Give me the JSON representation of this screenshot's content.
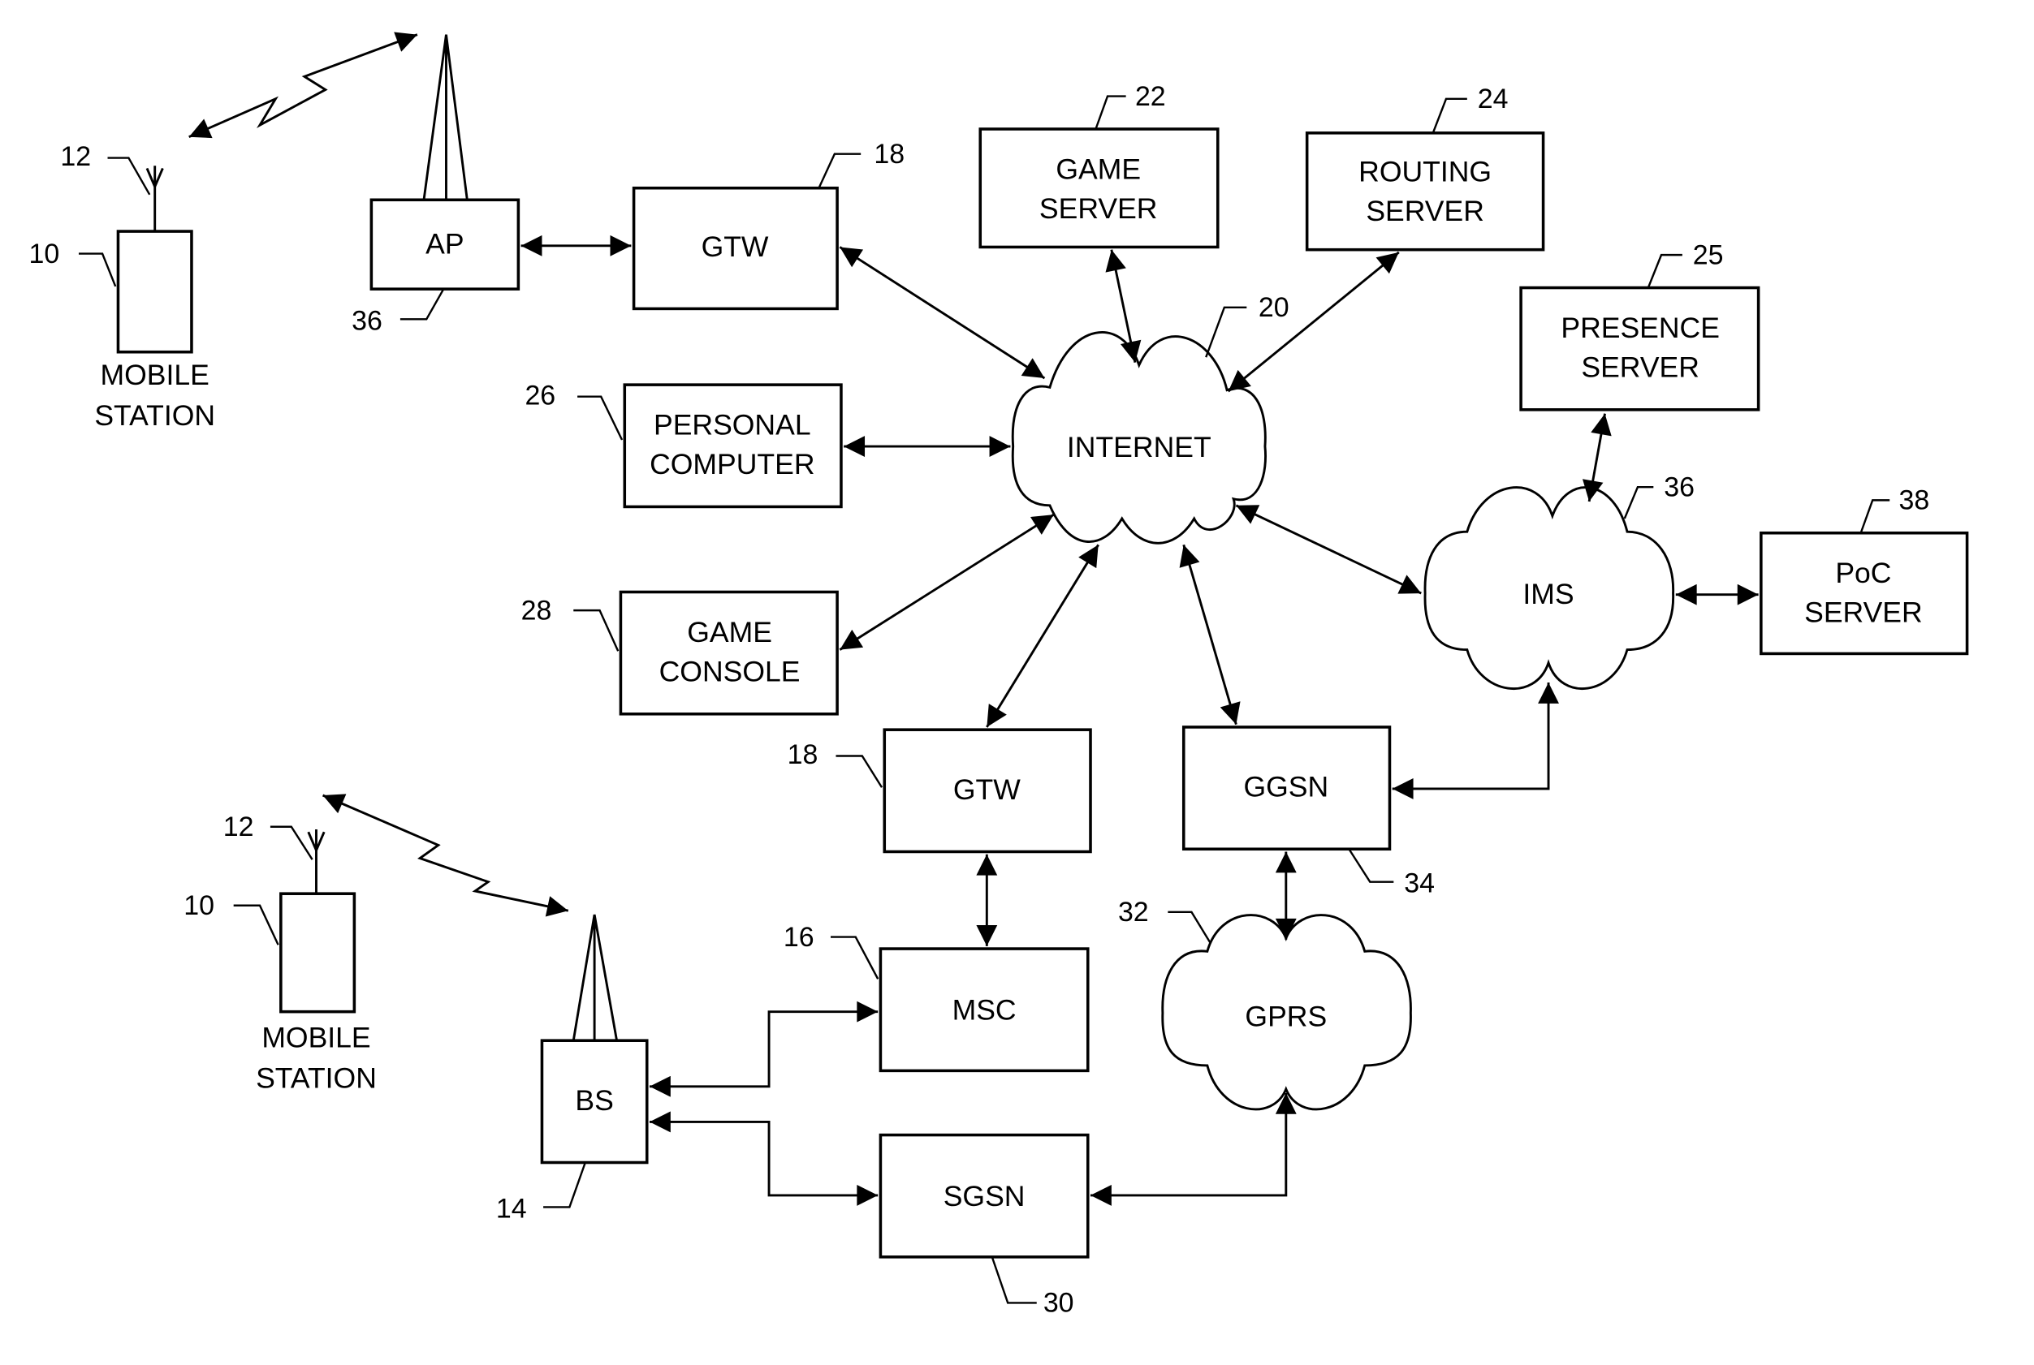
{
  "nodes": {
    "ms_top": {
      "lines": [
        "MOBILE",
        "STATION"
      ],
      "ref": "10",
      "antenna_ref": "12"
    },
    "ap": {
      "label": "AP",
      "ref": "36"
    },
    "gtw_top": {
      "label": "GTW",
      "ref": "18"
    },
    "game_server": {
      "lines": [
        "GAME",
        "SERVER"
      ],
      "ref": "22"
    },
    "routing_server": {
      "lines": [
        "ROUTING",
        "SERVER"
      ],
      "ref": "24"
    },
    "internet": {
      "label": "INTERNET",
      "ref": "20"
    },
    "presence_server": {
      "lines": [
        "PRESENCE",
        "SERVER"
      ],
      "ref": "25"
    },
    "personal_computer": {
      "lines": [
        "PERSONAL",
        "COMPUTER"
      ],
      "ref": "26"
    },
    "game_console": {
      "lines": [
        "GAME",
        "CONSOLE"
      ],
      "ref": "28"
    },
    "ims": {
      "label": "IMS",
      "ref": "36"
    },
    "poc_server": {
      "lines": [
        "PoC",
        "SERVER"
      ],
      "ref": "38"
    },
    "gtw_bottom": {
      "label": "GTW",
      "ref": "18"
    },
    "ggsn": {
      "label": "GGSN",
      "ref": "34"
    },
    "ms_bottom": {
      "lines": [
        "MOBILE",
        "STATION"
      ],
      "ref": "10",
      "antenna_ref": "12"
    },
    "msc": {
      "label": "MSC",
      "ref": "16"
    },
    "gprs": {
      "label": "GPRS",
      "ref": "32"
    },
    "bs": {
      "label": "BS",
      "ref": "14"
    },
    "sgsn": {
      "label": "SGSN",
      "ref": "30"
    }
  }
}
